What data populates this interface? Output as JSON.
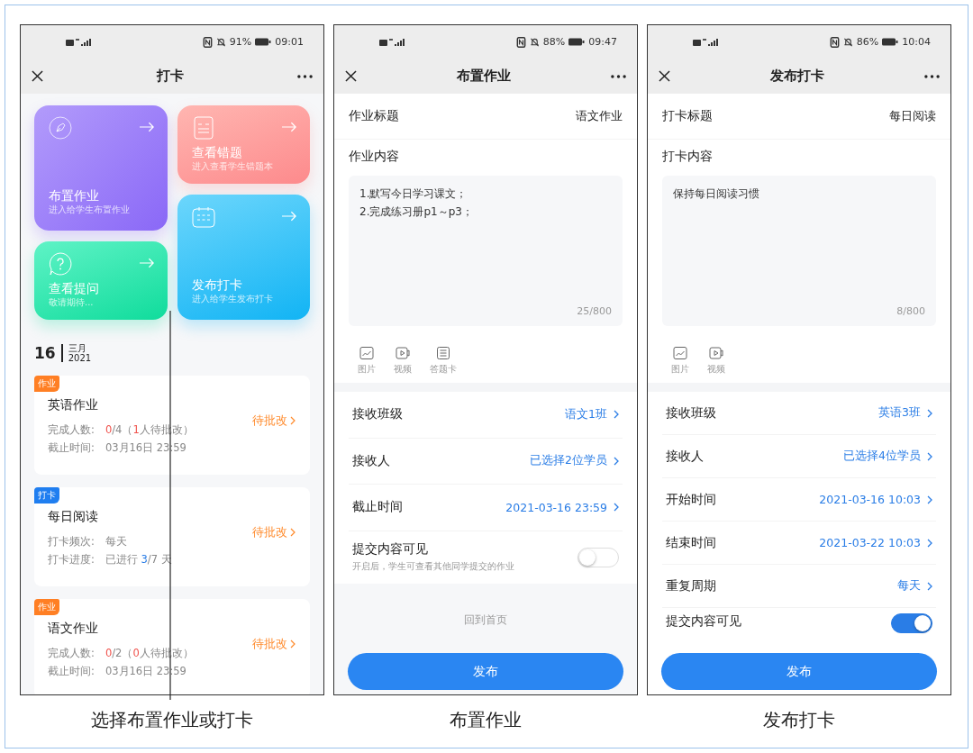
{
  "panels": [
    {
      "kind": "dashboard",
      "status_bar": {
        "battery": "91%",
        "time": "09:01"
      },
      "title": "打卡",
      "caption": "选择布置作业或打卡",
      "tile_columns": [
        [
          {
            "kind": "pen",
            "title": "布置作业",
            "subtitle": "进入给学生布置作业"
          },
          {
            "kind": "question",
            "title": "查看提问",
            "subtitle": "敬请期待..."
          }
        ],
        [
          {
            "kind": "errors",
            "title": "查看错题",
            "subtitle": "进入查看学生错题本"
          },
          {
            "kind": "calendar",
            "title": "发布打卡",
            "subtitle": "进入给学生发布打卡"
          }
        ]
      ],
      "date": {
        "day": "16",
        "month": "三月",
        "year": "2021"
      },
      "cards": [
        {
          "tag": "作业",
          "color": "#ff7f24",
          "title": "英语作业",
          "status": "待批改",
          "lines": [
            {
              "label": "完成人数:",
              "parts": [
                {
                  "text": "0",
                  "color": "#f0524c"
                },
                {
                  "text": "/4（"
                },
                {
                  "text": "1",
                  "color": "#f0524c"
                },
                {
                  "text": "人待批改）"
                }
              ]
            },
            {
              "label": "截止时间:",
              "parts": [
                {
                  "text": "03月16日 23:59"
                }
              ]
            }
          ]
        },
        {
          "tag": "打卡",
          "color": "#1f7ef0",
          "title": "每日阅读",
          "status": "待批改",
          "lines": [
            {
              "label": "打卡频次:",
              "parts": [
                {
                  "text": "每天"
                }
              ]
            },
            {
              "label": "打卡进度:",
              "parts": [
                {
                  "text": "已进行 "
                },
                {
                  "text": "3",
                  "color": "#2a7de6"
                },
                {
                  "text": "/7 天"
                }
              ]
            }
          ]
        },
        {
          "tag": "作业",
          "color": "#ff7f24",
          "title": "语文作业",
          "status": "待批改",
          "lines": [
            {
              "label": "完成人数:",
              "parts": [
                {
                  "text": "0",
                  "color": "#f0524c"
                },
                {
                  "text": "/2（"
                },
                {
                  "text": "0",
                  "color": "#f0524c"
                },
                {
                  "text": "人待批改）"
                }
              ]
            },
            {
              "label": "截止时间:",
              "parts": [
                {
                  "text": "03月16日 23:59"
                }
              ]
            }
          ]
        }
      ]
    },
    {
      "kind": "form",
      "status_bar": {
        "battery": "88%",
        "time": "09:47"
      },
      "title": "布置作业",
      "caption": "布置作业",
      "title_row": {
        "label": "作业标题",
        "value": "语文作业"
      },
      "content": {
        "label": "作业内容",
        "text": "1.默写今日学习课文；\n2.完成练习册p1～p3；",
        "counter": "25/800"
      },
      "attachments": [
        {
          "kind": "image",
          "label": "图片"
        },
        {
          "kind": "video",
          "label": "视频"
        },
        {
          "kind": "answer-sheet",
          "label": "答题卡"
        }
      ],
      "fields": [
        {
          "kind": "link",
          "label": "接收班级",
          "value": "语文1班"
        },
        {
          "kind": "link",
          "label": "接收人",
          "value": "已选择2位学员"
        },
        {
          "kind": "link",
          "label": "截止时间",
          "value": "2021-03-16 23:59"
        },
        {
          "kind": "toggle",
          "label": "提交内容可见",
          "hint": "开启后，学生可查看其他同学提交的作业",
          "on": false
        }
      ],
      "footer_link": "回到首页",
      "button": "发布"
    },
    {
      "kind": "form",
      "status_bar": {
        "battery": "86%",
        "time": "10:04"
      },
      "title": "发布打卡",
      "caption": "发布打卡",
      "title_row": {
        "label": "打卡标题",
        "value": "每日阅读"
      },
      "content": {
        "label": "打卡内容",
        "text": "保持每日阅读习惯",
        "counter": "8/800"
      },
      "attachments": [
        {
          "kind": "image",
          "label": "图片"
        },
        {
          "kind": "video",
          "label": "视频"
        }
      ],
      "fields": [
        {
          "kind": "link",
          "label": "接收班级",
          "value": "英语3班"
        },
        {
          "kind": "link",
          "label": "接收人",
          "value": "已选择4位学员"
        },
        {
          "kind": "link",
          "label": "开始时间",
          "value": "2021-03-16 10:03"
        },
        {
          "kind": "link",
          "label": "结束时间",
          "value": "2021-03-22 10:03"
        },
        {
          "kind": "link",
          "label": "重复周期",
          "value": "每天"
        },
        {
          "kind": "toggle",
          "label": "提交内容可见",
          "on": true
        }
      ],
      "button": "发布"
    }
  ]
}
